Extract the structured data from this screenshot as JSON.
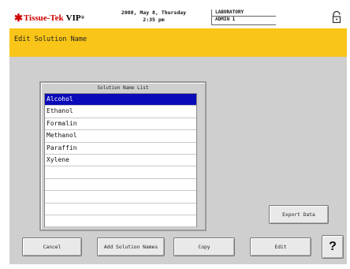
{
  "header": {
    "logo_brand": "Tissue-Tek",
    "logo_product": "VIP",
    "logo_tm": "®",
    "date_line": "2008, May 8, Thursday",
    "time_line": "2:35 pm",
    "user_group": "LABORATORY",
    "user_name": "ADMIN 1",
    "lock_icon": "padlock-icon"
  },
  "title": "Edit Solution Name",
  "solution_list": {
    "title": "Solution Name List",
    "items": [
      "Alcohol",
      "Ethanol",
      "Formalin",
      "Methanol",
      "Paraffin",
      "Xylene",
      "",
      "",
      "",
      "",
      ""
    ],
    "selected_index": 0
  },
  "buttons": {
    "export": "Export Data",
    "cancel": "Cancel",
    "add": "Add Solution Names",
    "copy": "Copy",
    "edit": "Edit",
    "help": "?"
  },
  "colors": {
    "title_bar": "#f8c518",
    "selection": "#0a0ab8",
    "brand_red": "#d10000"
  }
}
